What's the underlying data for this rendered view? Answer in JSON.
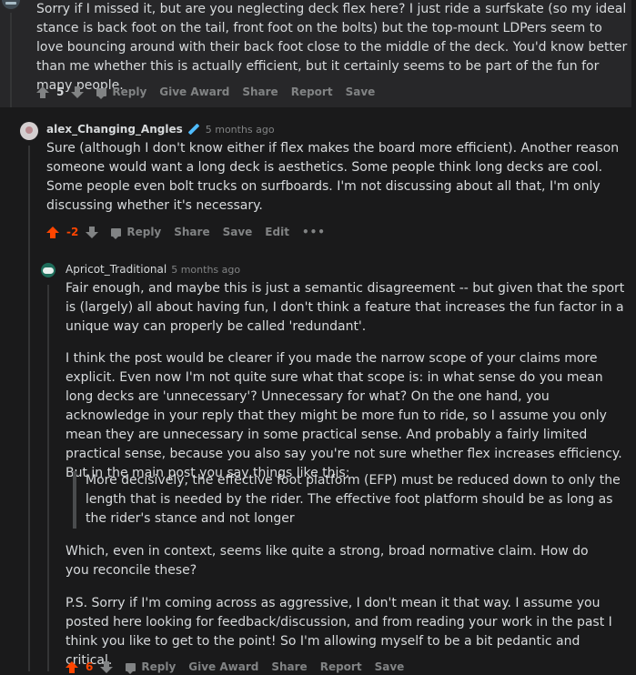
{
  "comment1": {
    "paragraphs": [
      "Sorry if I missed it, but are you neglecting deck flex here? I just ride a surfskate (so my ideal stance is back foot on the tail, front foot on the bolts) but the top-mount LDPers seem to love bouncing around with their back foot close to the middle of the deck. You'd know better than me whether this is actually efficient, but it certainly seems to be part of the fun for many people."
    ],
    "score": "5",
    "actions": {
      "reply": "Reply",
      "award": "Give Award",
      "share": "Share",
      "report": "Report",
      "save": "Save"
    }
  },
  "comment2": {
    "author": "alex_Changing_Angles",
    "time": "5 months ago",
    "paragraphs": [
      "Sure (although I don't know either if flex makes the board more efficient). Another reason someone would want a long deck is aesthetics. Some people think long decks are cool. Some people even bolt trucks on surfboards. I'm not discussing about all that, I'm only discussing whether it's necessary."
    ],
    "score": "-2",
    "actions": {
      "reply": "Reply",
      "share": "Share",
      "save": "Save",
      "edit": "Edit",
      "more": "•••"
    }
  },
  "comment3": {
    "author": "Apricot_Traditional",
    "time": "5 months ago",
    "p1": "Fair enough, and maybe this is just a semantic disagreement -- but given that the sport is (largely) all about having fun, I don't think a feature that increases the fun factor in a unique way can properly be called 'redundant'.",
    "p2": "I think the post would be clearer if you made the narrow scope of your claims more explicit. Even now I'm not quite sure what that scope is: in what sense do you mean long decks are 'unnecessary'? Unnecessary for what? On the one hand, you acknowledge in your reply that they might be more fun to ride, so I assume you only mean they are unnecessary in some practical sense. And probably a fairly limited practical sense, because you also say you're not sure whether flex increases efficiency. But in the main post you say things like this:",
    "quote": "More decisively, the effective foot platform (EFP) must be reduced down to only the length that is needed by the rider. The effective foot platform should be as long as the rider's stance and not longer",
    "p3": "Which, even in context, seems like quite a strong, broad normative claim. How do you reconcile these?",
    "p4": "P.S. Sorry if I'm coming across as aggressive, I don't mean it that way. I assume you posted here looking for feedback/discussion, and from reading your work in the past I think you like to get to the point! So I'm allowing myself to be a bit pedantic and critical.",
    "score": "6",
    "actions": {
      "reply": "Reply",
      "award": "Give Award",
      "share": "Share",
      "report": "Report",
      "save": "Save"
    }
  },
  "colors": {
    "upvote": "#ff4500",
    "background": "#1a1a1b",
    "panel": "#272729",
    "muted": "#818384",
    "text": "#d7dadc"
  }
}
